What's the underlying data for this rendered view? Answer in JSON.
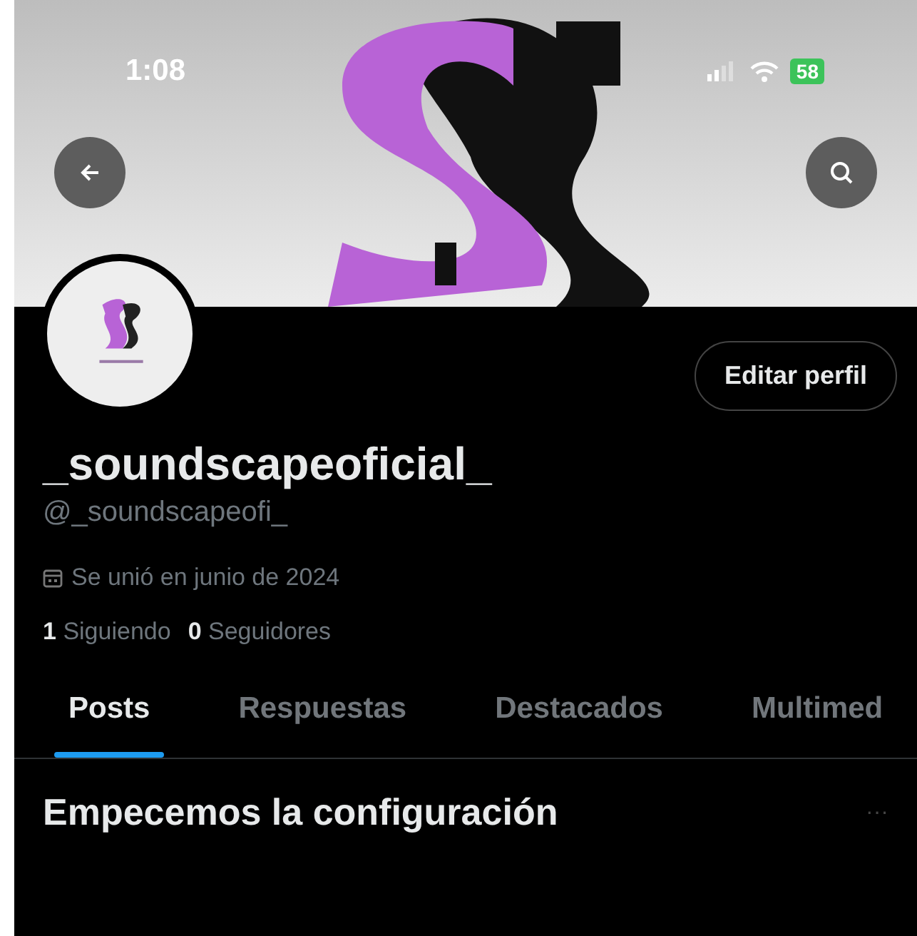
{
  "status_bar": {
    "time": "1:08",
    "battery": "58"
  },
  "profile": {
    "display_name": "_soundscapeoficial_",
    "handle": "@_soundscapeofi_",
    "joined": "Se unió en junio de 2024",
    "edit_button": "Editar perfil",
    "stats": [
      {
        "count": "1",
        "label": "Siguiendo"
      },
      {
        "count": "0",
        "label": "Seguidores"
      }
    ]
  },
  "tabs": [
    {
      "label": "Posts",
      "selected": true
    },
    {
      "label": "Respuestas",
      "selected": false
    },
    {
      "label": "Destacados",
      "selected": false
    },
    {
      "label": "Multimed",
      "selected": false
    }
  ],
  "section": {
    "title": "Empecemos la configuración",
    "more": "···"
  }
}
